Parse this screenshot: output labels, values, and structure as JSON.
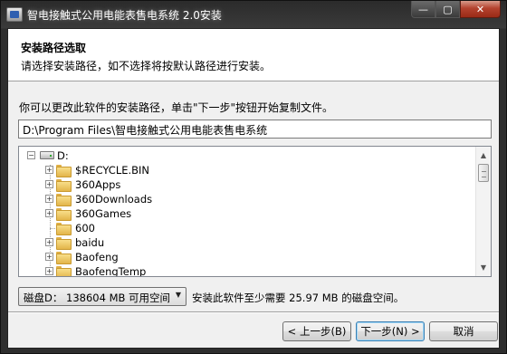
{
  "window": {
    "title": "智电接触式公用电能表售电系统 2.0安装",
    "caption": {
      "min": "—",
      "max": "▢",
      "close": "✕"
    }
  },
  "header": {
    "title": "安装路径选取",
    "subtitle": "请选择安装路径，如不选择将按默认路径进行安装。"
  },
  "intro_text": "你可以更改此软件的安装路径，单击\"下一步\"按钮开始复制文件。",
  "install_path": "D:\\Program Files\\智电接触式公用电能表售电系统",
  "tree": {
    "root": "D:",
    "folders": [
      {
        "name": "$RECYCLE.BIN",
        "expandable": true
      },
      {
        "name": "360Apps",
        "expandable": true
      },
      {
        "name": "360Downloads",
        "expandable": true
      },
      {
        "name": "360Games",
        "expandable": true
      },
      {
        "name": "600",
        "expandable": false
      },
      {
        "name": "baidu",
        "expandable": true
      },
      {
        "name": "Baofeng",
        "expandable": true
      },
      {
        "name": "BaofengTemp",
        "expandable": true
      }
    ]
  },
  "drive_select": {
    "value": "磁盘D：  138604 MB 可用空间"
  },
  "space_note": "安装此软件至少需要 25.97 MB 的磁盘空间。",
  "buttons": {
    "back": "< 上一步(B)",
    "next": "下一步(N) >",
    "cancel": "取消"
  }
}
